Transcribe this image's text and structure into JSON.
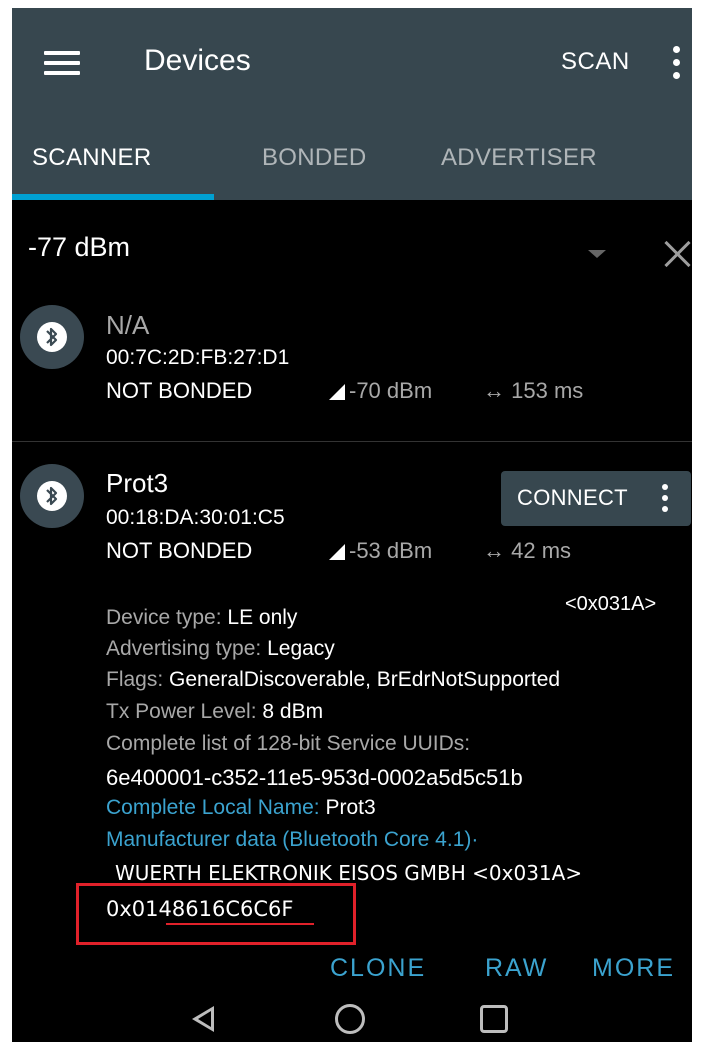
{
  "appbar": {
    "title": "Devices",
    "scan_label": "SCAN",
    "menu_icon": "menu-icon",
    "more_icon": "more-vert-icon"
  },
  "tabs": [
    {
      "label": "SCANNER",
      "active": true
    },
    {
      "label": "BONDED",
      "active": false
    },
    {
      "label": "ADVERTISER",
      "active": false
    }
  ],
  "filter": {
    "label": "-77 dBm"
  },
  "devices": [
    {
      "name": "N/A",
      "address": "00:7C:2D:FB:27:D1",
      "bond_state": "NOT BONDED",
      "rssi": "-70 dBm",
      "interval": "153 ms"
    },
    {
      "name": "Prot3",
      "address": "00:18:DA:30:01:C5",
      "bond_state": "NOT BONDED",
      "rssi": "-53 dBm",
      "interval": "42 ms",
      "connect_label": "CONNECT",
      "manufacturer_id_top": "<0x031A>",
      "details": {
        "device_type_key": "Device type: ",
        "device_type_val": "LE only",
        "adv_type_key": "Advertising type: ",
        "adv_type_val": "Legacy",
        "flags_key": "Flags: ",
        "flags_val": "GeneralDiscoverable, BrEdrNotSupported",
        "tx_key": "Tx Power Level: ",
        "tx_val": "8 dBm",
        "uuids_key": "Complete list of 128-bit Service UUIDs:",
        "uuids_val": "6e400001-c352-11e5-953d-0002a5d5c51b",
        "local_name_key": "Complete Local Name: ",
        "local_name_val": "Prot3",
        "mfr_key": "Manufacturer data (Bluetooth Core 4.1)·",
        "mfr_line": "WUERTH ELEKTRONIK EISOS GMBH <0x031A>",
        "mfr_data": "0x0148616C6C6F"
      },
      "actions": {
        "clone": "CLONE",
        "raw": "RAW",
        "more": "MORE"
      }
    }
  ],
  "accent_color": "#00a0d2",
  "appbar_color": "#37474f",
  "highlight_color": "#e0212a"
}
